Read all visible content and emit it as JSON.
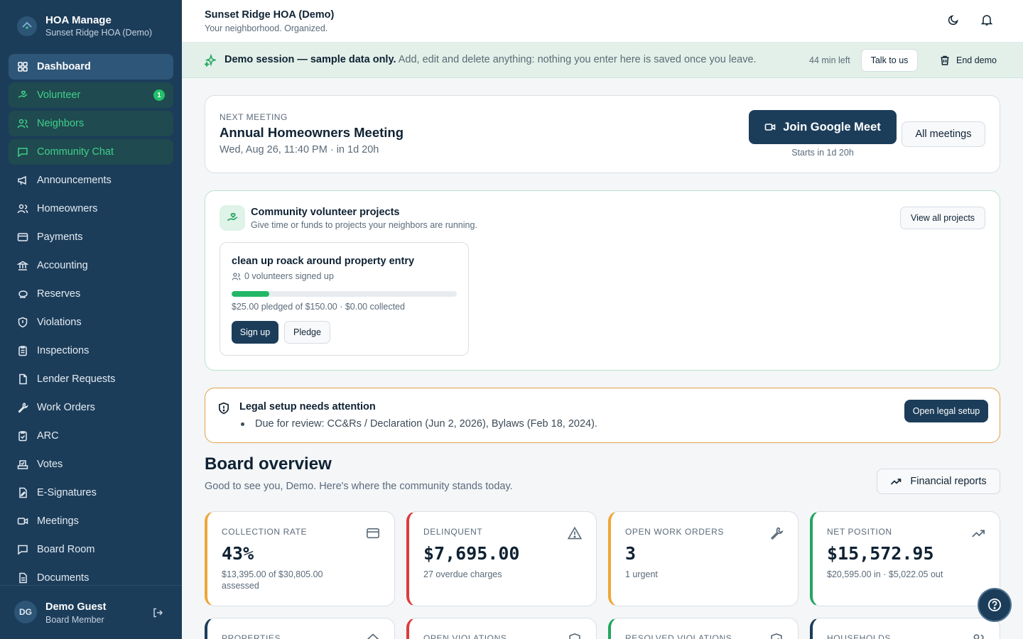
{
  "sidebar": {
    "brand_title": "HOA Manage",
    "brand_sub": "Sunset Ridge HOA (Demo)",
    "items": [
      {
        "label": "Dashboard",
        "icon": "dashboard-icon"
      },
      {
        "label": "Volunteer",
        "icon": "hand-heart-icon",
        "badge": "1"
      },
      {
        "label": "Neighbors",
        "icon": "users-icon"
      },
      {
        "label": "Community Chat",
        "icon": "chat-icon"
      },
      {
        "label": "Announcements",
        "icon": "megaphone-icon"
      },
      {
        "label": "Homeowners",
        "icon": "users-icon"
      },
      {
        "label": "Payments",
        "icon": "credit-card-icon"
      },
      {
        "label": "Accounting",
        "icon": "bank-icon"
      },
      {
        "label": "Reserves",
        "icon": "piggy-bank-icon"
      },
      {
        "label": "Violations",
        "icon": "shield-icon"
      },
      {
        "label": "Inspections",
        "icon": "clipboard-icon"
      },
      {
        "label": "Lender Requests",
        "icon": "file-icon"
      },
      {
        "label": "Work Orders",
        "icon": "wrench-icon"
      },
      {
        "label": "ARC",
        "icon": "clipboard-check-icon"
      },
      {
        "label": "Votes",
        "icon": "vote-icon"
      },
      {
        "label": "E-Signatures",
        "icon": "signature-icon"
      },
      {
        "label": "Meetings",
        "icon": "video-icon"
      },
      {
        "label": "Board Room",
        "icon": "message-square-icon"
      },
      {
        "label": "Documents",
        "icon": "document-icon"
      }
    ],
    "user": {
      "initials": "DG",
      "name": "Demo Guest",
      "role": "Board Member"
    }
  },
  "header": {
    "title": "Sunset Ridge HOA (Demo)",
    "subtitle": "Your neighborhood. Organized."
  },
  "banner": {
    "bold": "Demo session — sample data only.",
    "rest": " Add, edit and delete anything: nothing you enter here is saved once you leave.",
    "time_left": "44 min left",
    "talk_label": "Talk to us",
    "end_label": "End demo"
  },
  "meeting": {
    "eyebrow": "NEXT MEETING",
    "title": "Annual Homeowners Meeting",
    "when": "Wed, Aug 26, 11:40 PM · in 1d 20h",
    "join_label": "Join Google Meet",
    "starts_in": "Starts in 1d 20h",
    "all_label": "All meetings"
  },
  "volunteer": {
    "title": "Community volunteer projects",
    "subtitle": "Give time or funds to projects your neighbors are running.",
    "view_all_label": "View all projects",
    "project": {
      "title": "clean up roack around property entry",
      "volunteers": "0 volunteers signed up",
      "progress": 0.1667,
      "pledged": "$25.00 pledged of $150.00 · $0.00 collected",
      "signup_label": "Sign up",
      "pledge_label": "Pledge"
    }
  },
  "legal": {
    "title": "Legal setup needs attention",
    "item": "Due for review: CC&Rs / Declaration (Jun 2, 2026), Bylaws (Feb 18, 2024).",
    "button_label": "Open legal setup"
  },
  "overview": {
    "title": "Board overview",
    "subtitle": "Good to see you, Demo. Here's where the community stands today.",
    "fin_label": "Financial reports",
    "stats": [
      {
        "label": "COLLECTION RATE",
        "value": "43%",
        "sub": "$13,395.00 of $30,805.00 assessed",
        "color": "#f0a638",
        "icon": "credit-card-icon"
      },
      {
        "label": "DELINQUENT",
        "value": "$7,695.00",
        "sub": "27 overdue charges",
        "color": "#dc3b3b",
        "icon": "warning-icon"
      },
      {
        "label": "OPEN WORK ORDERS",
        "value": "3",
        "sub": "1 urgent",
        "color": "#f0a638",
        "icon": "wrench-icon"
      },
      {
        "label": "NET POSITION",
        "value": "$15,572.95",
        "sub": "$20,595.00 in · $5,022.05 out",
        "color": "#22a65e",
        "icon": "trending-up-icon"
      }
    ],
    "stats_row2": [
      {
        "label": "PROPERTIES",
        "color": "#1c3d5a",
        "icon": "home-icon"
      },
      {
        "label": "OPEN VIOLATIONS",
        "color": "#dc3b3b",
        "icon": "shield-icon"
      },
      {
        "label": "RESOLVED VIOLATIONS",
        "color": "#22a65e",
        "icon": "shield-check-icon"
      },
      {
        "label": "HOUSEHOLDS",
        "color": "#1c3d5a",
        "icon": "users-icon"
      }
    ]
  }
}
